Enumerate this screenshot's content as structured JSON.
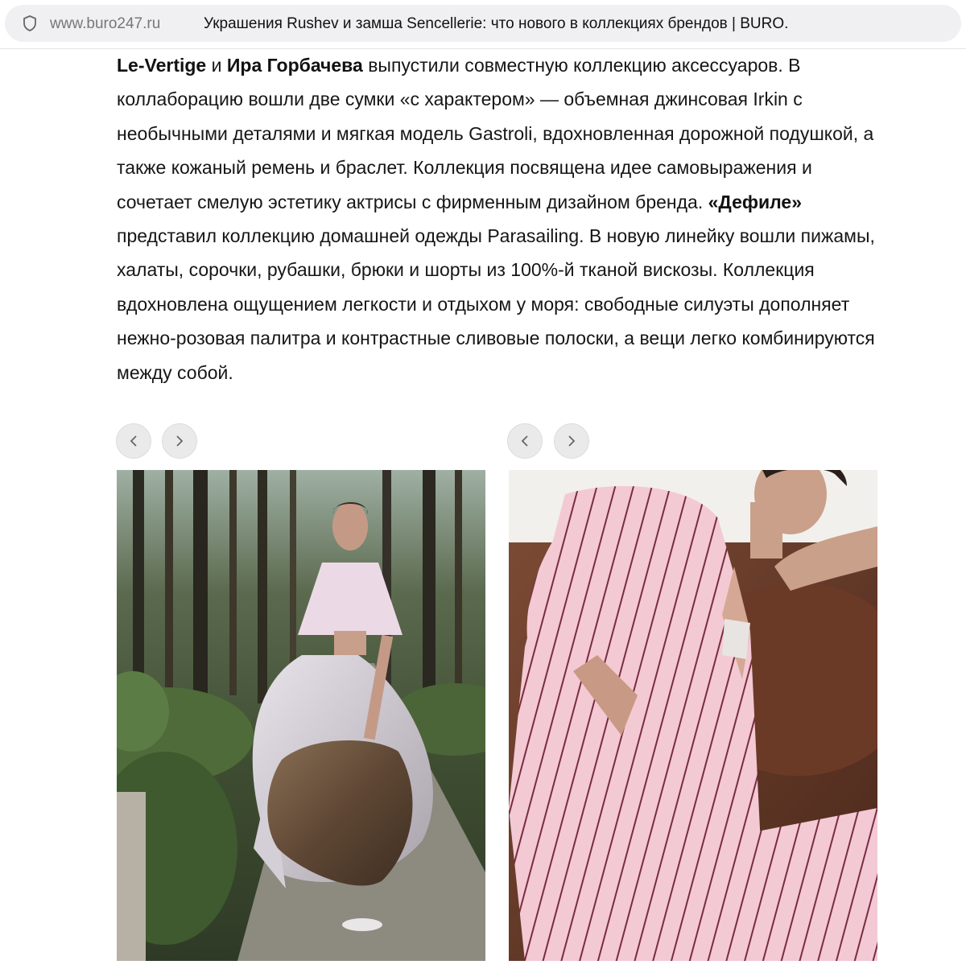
{
  "browser": {
    "domain": "www.buro247.ru",
    "page_title": "Украшения Rushev и замша Sencellerie: что нового в коллекциях брендов | BURO."
  },
  "article": {
    "brand1": "Le-Vertige",
    "conj": " и ",
    "person": "Ира Горбачева",
    "text1": " выпустили совместную коллекцию аксессуаров. В коллаборацию вошли две сумки «с характером» — объемная джинсовая Irkin с необычными деталями и мягкая модель Gastroli, вдохновленная дорожной подушкой, а также кожаный ремень и браслет. Коллекция посвящена идее самовыражения и сочетает смелую эстетику актрисы с фирменным дизайном бренда. ",
    "brand2": "«Дефиле»",
    "text2": " представил коллекцию домашней одежды Parasailing. В новую линейку вошли пижамы, халаты, сорочки, рубашки, брюки и шорты из 100%-й тканой вискозы. Коллекция вдохновлена ощущением легкости и отдыхом у моря: свободные силуэты дополняет нежно-розовая палитра и контрастные сливовые полоски, а вещи легко комбинируются между собой."
  },
  "galleries": [
    {
      "prev_icon": "chevron-left-icon",
      "next_icon": "chevron-right-icon"
    },
    {
      "prev_icon": "chevron-left-icon",
      "next_icon": "chevron-right-icon"
    }
  ],
  "colors": {
    "address_bar_bg": "#f0f0f2",
    "nav_button_bg": "#eaeaea",
    "text": "#161616"
  }
}
